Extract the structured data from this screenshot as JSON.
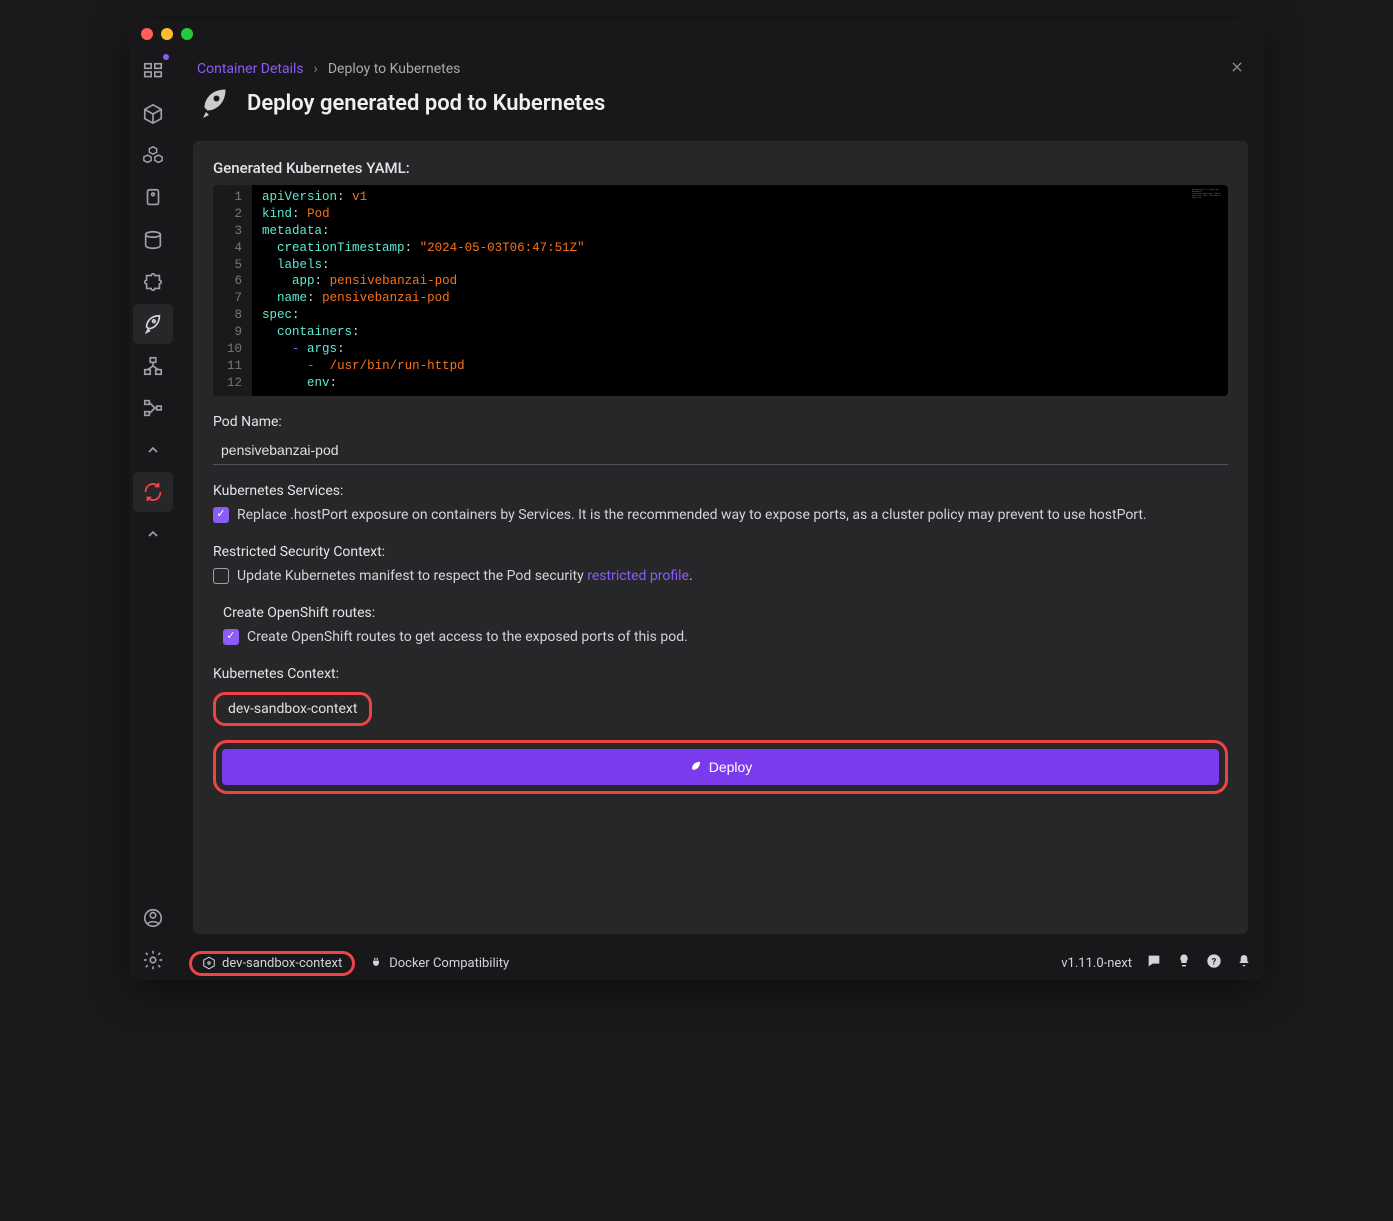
{
  "breadcrumb": {
    "parent": "Container Details",
    "current": "Deploy to Kubernetes"
  },
  "page_title": "Deploy generated pod to Kubernetes",
  "yaml": {
    "label": "Generated Kubernetes YAML:",
    "lines": [
      {
        "n": 1,
        "indent": 0,
        "dash": false,
        "key": "apiVersion",
        "val": "v1",
        "quoted": false
      },
      {
        "n": 2,
        "indent": 0,
        "dash": false,
        "key": "kind",
        "val": "Pod",
        "quoted": false
      },
      {
        "n": 3,
        "indent": 0,
        "dash": false,
        "key": "metadata",
        "val": null
      },
      {
        "n": 4,
        "indent": 1,
        "dash": false,
        "key": "creationTimestamp",
        "val": "2024-05-03T06:47:51Z",
        "quoted": true
      },
      {
        "n": 5,
        "indent": 1,
        "dash": false,
        "key": "labels",
        "val": null
      },
      {
        "n": 6,
        "indent": 2,
        "dash": false,
        "key": "app",
        "val": "pensivebanzai-pod",
        "quoted": false
      },
      {
        "n": 7,
        "indent": 1,
        "dash": false,
        "key": "name",
        "val": "pensivebanzai-pod",
        "quoted": false
      },
      {
        "n": 8,
        "indent": 0,
        "dash": false,
        "key": "spec",
        "val": null
      },
      {
        "n": 9,
        "indent": 1,
        "dash": false,
        "key": "containers",
        "val": null
      },
      {
        "n": 10,
        "indent": 2,
        "dash": true,
        "key": "args",
        "val": null
      },
      {
        "n": 11,
        "indent": 3,
        "dash": true,
        "key": null,
        "val": "/usr/bin/run-httpd",
        "quoted": false
      },
      {
        "n": 12,
        "indent": 3,
        "dash": false,
        "key": "env",
        "val": null
      }
    ]
  },
  "pod_name": {
    "label": "Pod Name:",
    "value": "pensivebanzai-pod"
  },
  "services": {
    "label": "Kubernetes Services:",
    "checked": true,
    "text": "Replace .hostPort exposure on containers by Services. It is the recommended way to expose ports, as a cluster policy may prevent to use hostPort."
  },
  "security": {
    "label": "Restricted Security Context:",
    "checked": false,
    "text_prefix": "Update Kubernetes manifest to respect the Pod security ",
    "link": "restricted profile",
    "text_suffix": "."
  },
  "routes": {
    "label": "Create OpenShift routes:",
    "checked": true,
    "text": "Create OpenShift routes to get access to the exposed ports of this pod."
  },
  "context": {
    "label": "Kubernetes Context:",
    "value": "dev-sandbox-context"
  },
  "deploy_label": "Deploy",
  "statusbar": {
    "context": "dev-sandbox-context",
    "docker": "Docker Compatibility",
    "version": "v1.11.0-next"
  }
}
